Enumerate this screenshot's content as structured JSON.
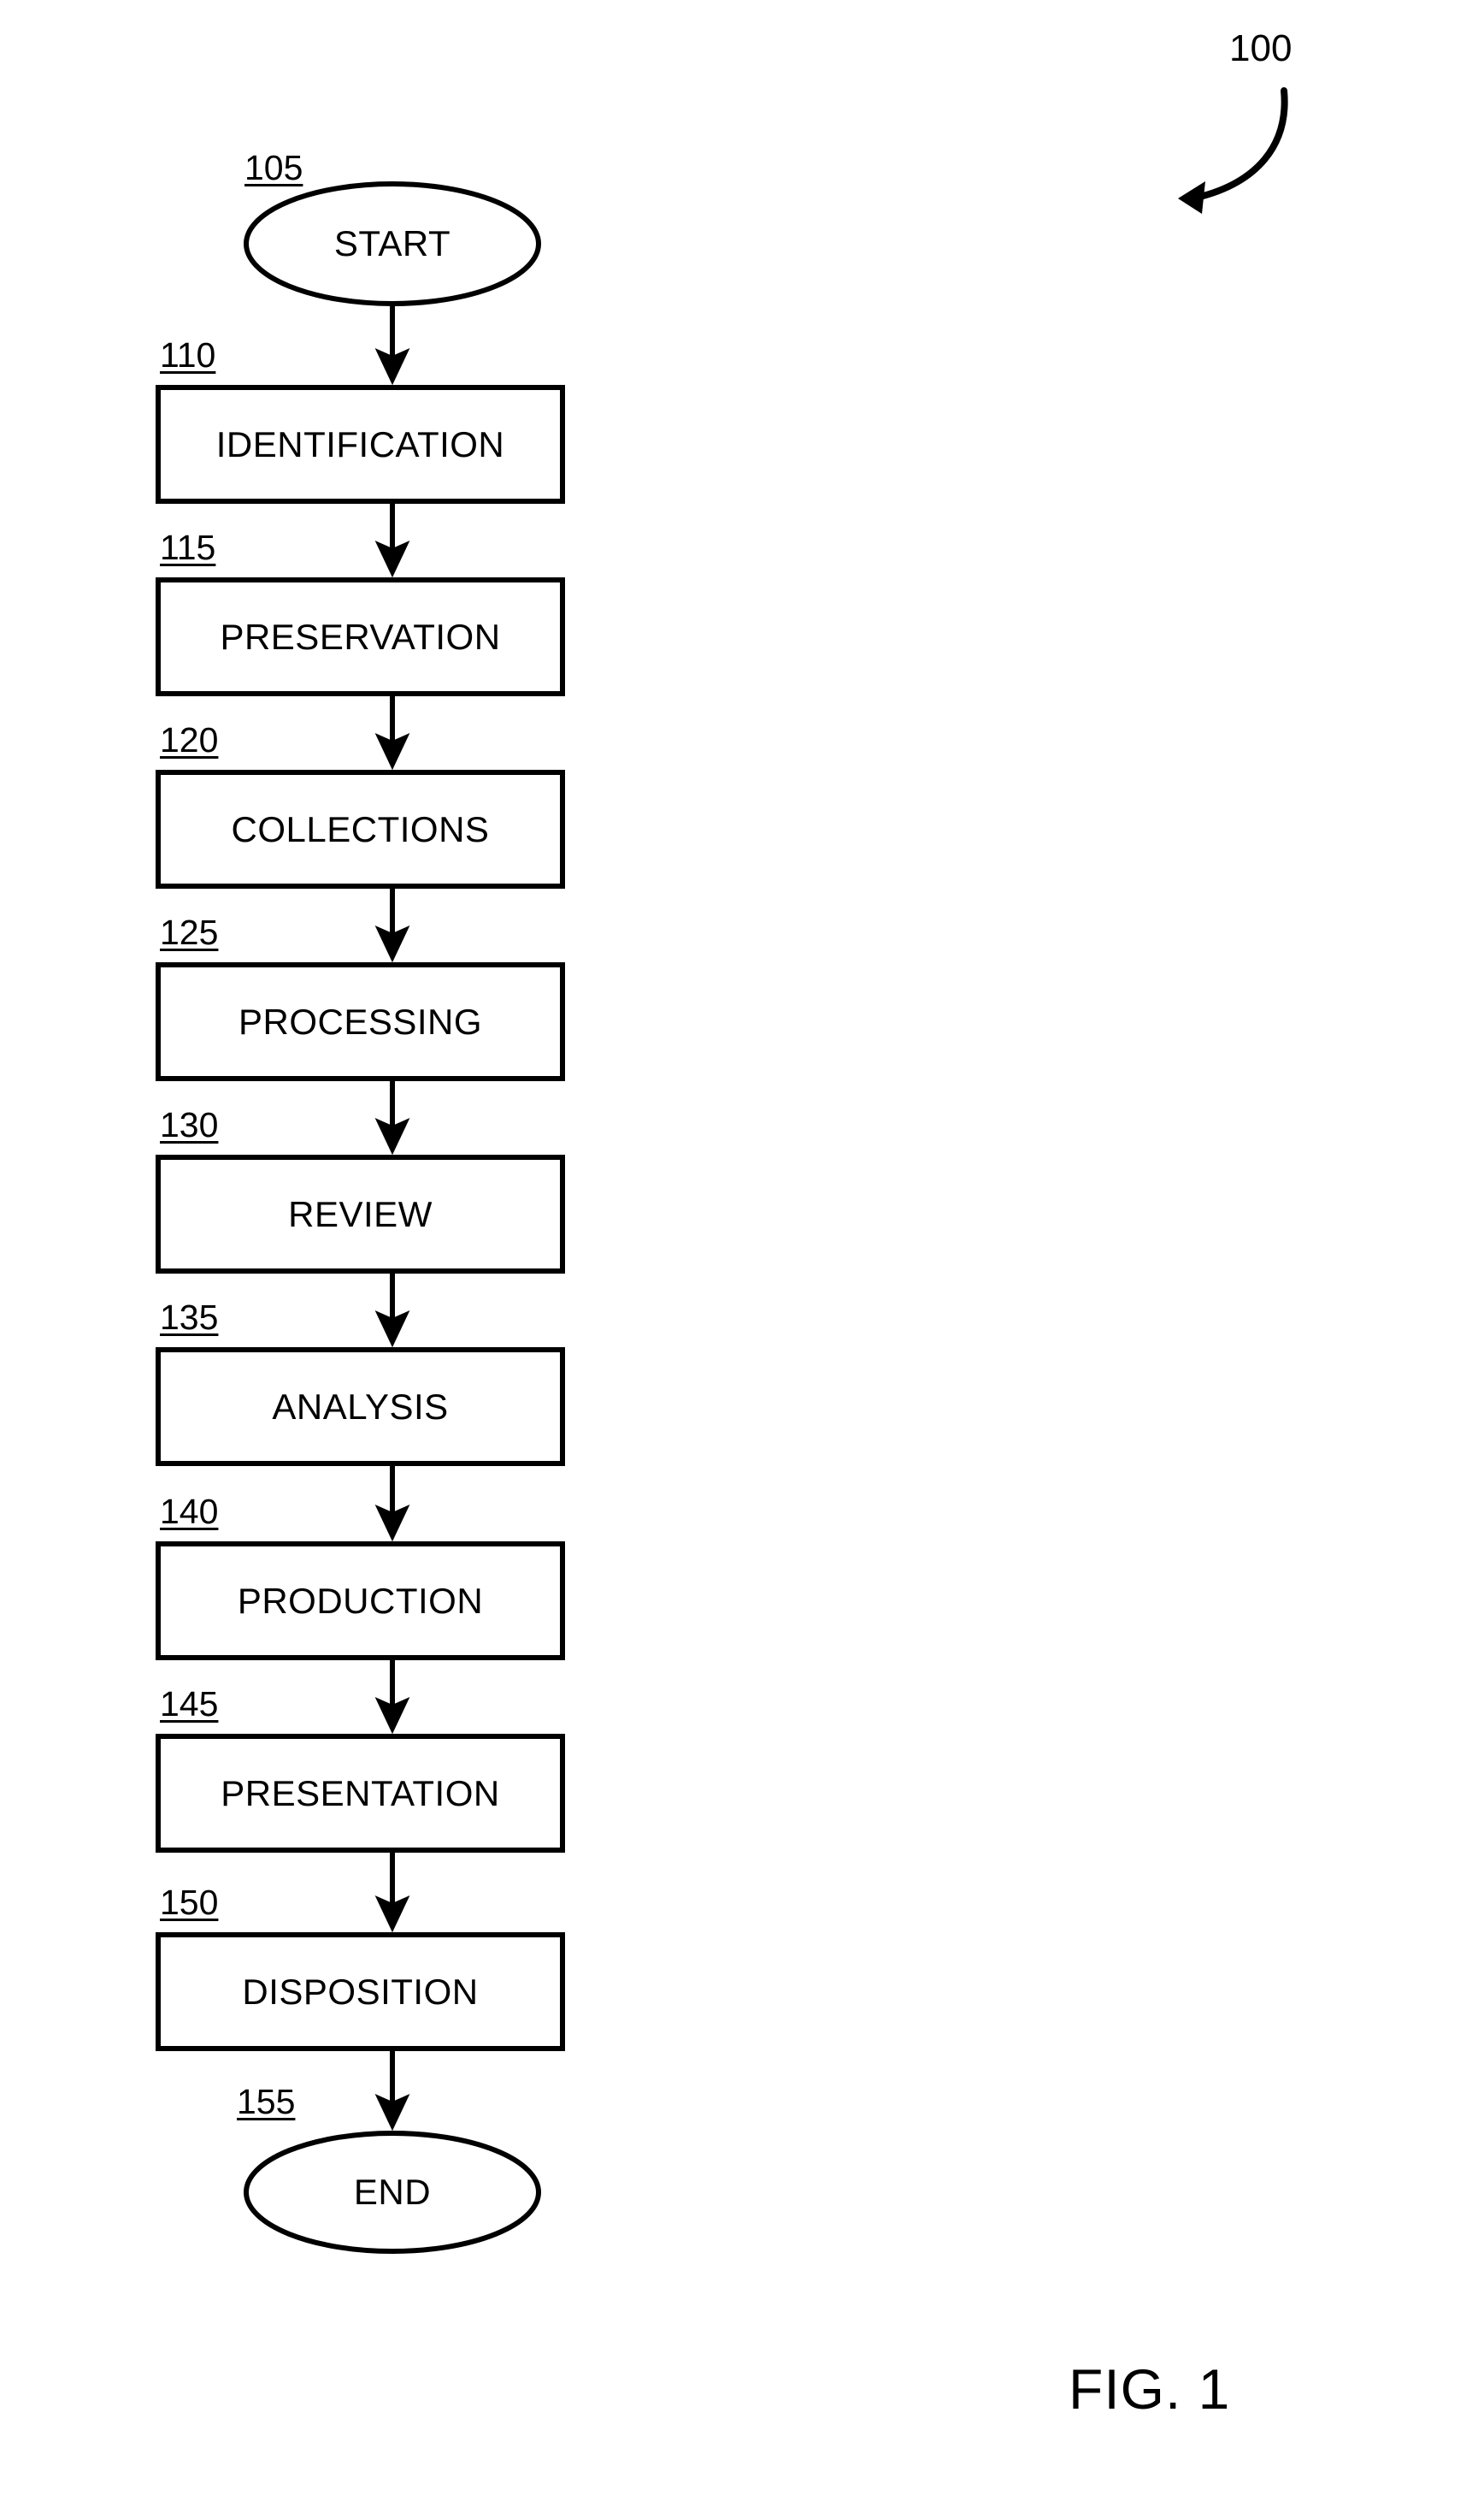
{
  "figure": {
    "caption": "FIG. 1",
    "system_reference": "100"
  },
  "flowchart": {
    "nodes": [
      {
        "ref": "105",
        "label": "START",
        "shape": "ellipse"
      },
      {
        "ref": "110",
        "label": "IDENTIFICATION",
        "shape": "rect"
      },
      {
        "ref": "115",
        "label": "PRESERVATION",
        "shape": "rect"
      },
      {
        "ref": "120",
        "label": "COLLECTIONS",
        "shape": "rect"
      },
      {
        "ref": "125",
        "label": "PROCESSING",
        "shape": "rect"
      },
      {
        "ref": "130",
        "label": "REVIEW",
        "shape": "rect"
      },
      {
        "ref": "135",
        "label": "ANALYSIS",
        "shape": "rect"
      },
      {
        "ref": "140",
        "label": "PRODUCTION",
        "shape": "rect"
      },
      {
        "ref": "145",
        "label": "PRESENTATION",
        "shape": "rect"
      },
      {
        "ref": "150",
        "label": "DISPOSITION",
        "shape": "rect"
      },
      {
        "ref": "155",
        "label": "END",
        "shape": "ellipse"
      }
    ],
    "colors": {
      "stroke": "#000000",
      "fill": "#ffffff",
      "text": "#000000"
    }
  }
}
